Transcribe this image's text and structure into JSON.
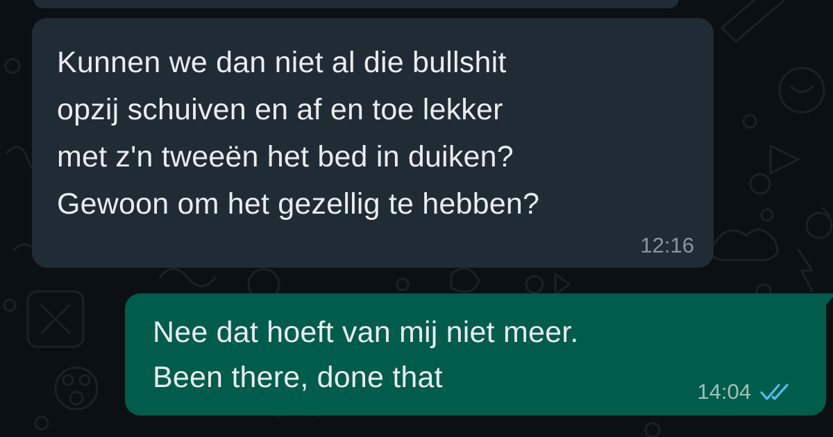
{
  "chat": {
    "messages": [
      {
        "direction": "incoming",
        "text": "Kunnen we dan niet al die bullshit\nopzij schuiven en af en toe lekker\nmet z'n tweeën het bed in duiken?\nGewoon om het gezellig te hebben?",
        "time": "12:16"
      },
      {
        "direction": "outgoing",
        "text": "Nee dat hoeft van mij niet meer.\nBeen there, done that",
        "time": "14:04",
        "status_icon": "double-check-read-icon",
        "status_color": "#53bdeb"
      }
    ]
  },
  "colors": {
    "background": "#0b1014",
    "incoming_bubble": "#1f2c33",
    "outgoing_bubble": "#005c4b",
    "text": "#e9edef",
    "meta": "#8696a0"
  }
}
